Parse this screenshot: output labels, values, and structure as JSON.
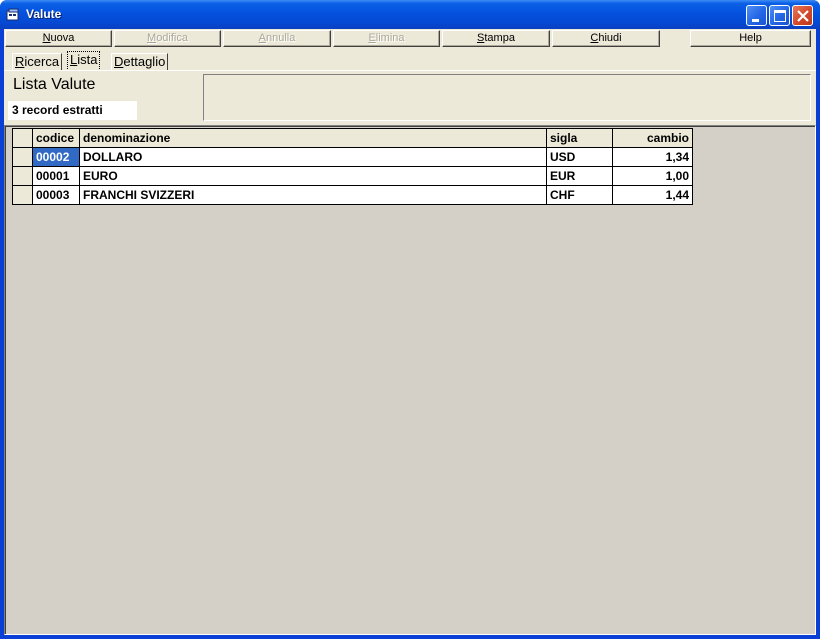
{
  "window": {
    "title": "Valute"
  },
  "toolbar": {
    "buttons": [
      {
        "label": "Nuova",
        "underline": "N",
        "enabled": true
      },
      {
        "label": "Modifica",
        "underline": "M",
        "enabled": false
      },
      {
        "label": "Annulla",
        "underline": "A",
        "enabled": false
      },
      {
        "label": "Elimina",
        "underline": "E",
        "enabled": false
      },
      {
        "label": "Stampa",
        "underline": "S",
        "enabled": true
      },
      {
        "label": "Chiudi",
        "underline": "C",
        "enabled": true
      },
      {
        "label": "Help",
        "underline": "",
        "enabled": true
      }
    ]
  },
  "tabs": [
    {
      "label": "Ricerca",
      "underline": "R",
      "active": false
    },
    {
      "label": "Lista",
      "underline": "L",
      "active": true
    },
    {
      "label": "Dettaglio",
      "underline": "D",
      "active": false
    }
  ],
  "header": {
    "title": "Lista Valute",
    "record_count": "3 record estratti"
  },
  "grid": {
    "columns": [
      "codice",
      "denominazione",
      "sigla",
      "cambio"
    ],
    "rows": [
      {
        "codice": "00002",
        "denominazione": "DOLLARO",
        "sigla": "USD",
        "cambio": "1,34"
      },
      {
        "codice": "00001",
        "denominazione": "EURO",
        "sigla": "EUR",
        "cambio": "1,00"
      },
      {
        "codice": "00003",
        "denominazione": "FRANCHI SVIZZERI",
        "sigla": "CHF",
        "cambio": "1,44"
      }
    ],
    "selected_row": 0
  },
  "colors": {
    "titlebar": "#0552de",
    "face": "#ece9d8",
    "grid_background": "#d4d0c8",
    "selection": "#316ac5"
  }
}
